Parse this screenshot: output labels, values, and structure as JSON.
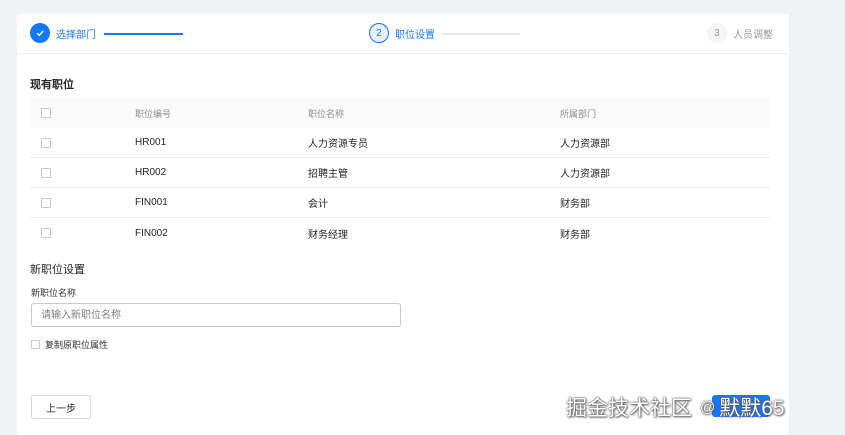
{
  "steps": [
    {
      "number": "✓",
      "title": "选择部门",
      "status": "finish"
    },
    {
      "number": "2",
      "title": "职位设置",
      "status": "process"
    },
    {
      "number": "3",
      "title": "人员调整",
      "status": "wait"
    }
  ],
  "existing_section": {
    "title": "现有职位"
  },
  "table": {
    "columns": [
      "职位编号",
      "职位名称",
      "所属部门"
    ],
    "rows": [
      {
        "code": "HR001",
        "name": "人力资源专员",
        "dept": "人力资源部"
      },
      {
        "code": "HR002",
        "name": "招聘主管",
        "dept": "人力资源部"
      },
      {
        "code": "FIN001",
        "name": "会计",
        "dept": "财务部"
      },
      {
        "code": "FIN002",
        "name": "财务经理",
        "dept": "财务部"
      }
    ]
  },
  "new_section": {
    "title": "新职位设置",
    "field_label": "新职位名称",
    "input_value": "",
    "input_placeholder": "请输入新职位名称",
    "copy_label": "复制原职位属性"
  },
  "footer": {
    "prev_label": "上一步"
  },
  "watermark": {
    "site": "掘金技术社区",
    "at": "@",
    "author": "默默65"
  },
  "colors": {
    "primary": "#1677ff",
    "border": "#d9d9d9",
    "text": "#262626",
    "muted": "#999999"
  }
}
